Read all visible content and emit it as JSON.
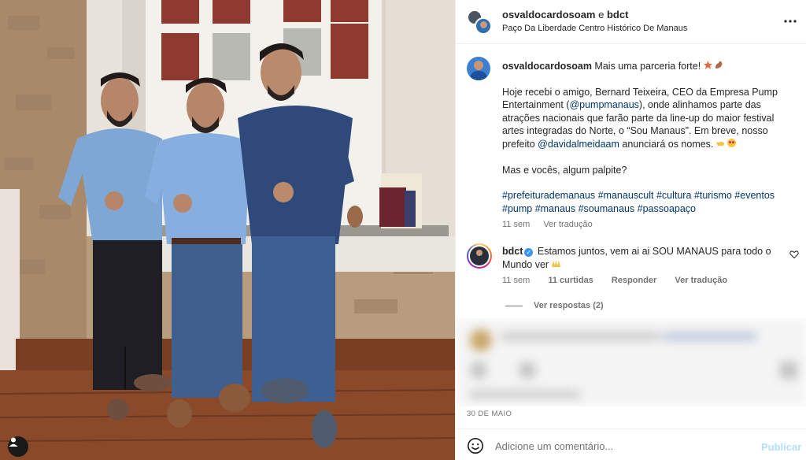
{
  "post": {
    "header": {
      "user1": "osvaldocardosoam",
      "joiner": "e",
      "user2": "bdct",
      "location": "Paço Da Liberdade Centro Histórico De Manaus"
    },
    "caption": {
      "username": "osvaldocardosoam",
      "first_line": "Mais uma parceria forte!",
      "p1_a": "Hoje recebi o amigo, Bernard Teixeira, CEO da Empresa Pump Entertainment (",
      "p1_mention1": "@pumpmanaus",
      "p1_b": "), onde alinhamos parte das atrações nacionais que farão parte da line-up do maior festival artes integradas do Norte, o “Sou Manaus”. Em breve, nosso prefeito ",
      "p1_mention2": "@davidalmeidaam",
      "p1_c": " anunciará os nomes.",
      "p2": "Mas e vocês, algum palpite?",
      "hashtags": "#prefeiturademanaus #manauscult #cultura #turismo #eventos #pump #manaus #soumanaus #passoapaço",
      "time": "11 sem",
      "see_translation": "Ver tradução"
    },
    "comment": {
      "username": "bdct",
      "text": "Estamos juntos, vem ai ai SOU MANAUS para todo o Mundo ver",
      "time": "11 sem",
      "likes": "11 curtidas",
      "reply": "Responder",
      "see_translation": "Ver tradução",
      "view_replies": "Ver respostas (2)"
    },
    "date": "30 DE MAIO",
    "add_comment": {
      "placeholder": "Adicione um comentário...",
      "publish": "Publicar"
    }
  },
  "icons": {
    "more": "more-horizontal-icon",
    "tag": "user-tag-icon",
    "heart": "heart-outline-icon",
    "emoji": "smiley-face-icon",
    "verified": "verified-badge-icon"
  },
  "colors": {
    "link": "#00376b",
    "muted": "#737373",
    "publish_disabled": "#b2dffc",
    "verified": "#3897f0"
  }
}
